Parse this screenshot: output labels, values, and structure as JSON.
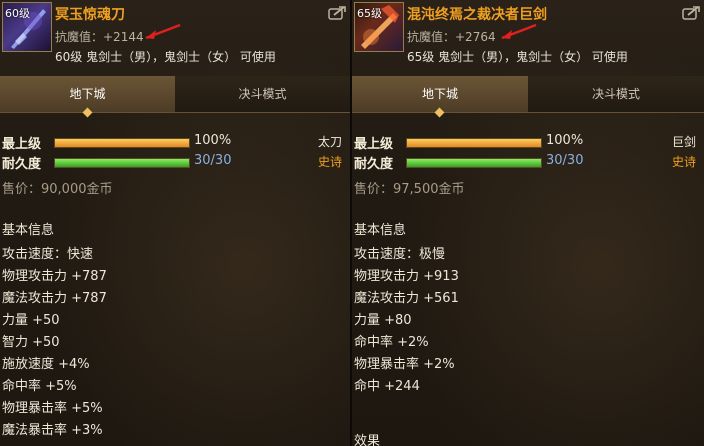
{
  "colors": {
    "item_name": "#f0a020",
    "durability_value": "#8ab0e0",
    "tag_epic": "#f0a020",
    "annotation_arrow": "#e02020"
  },
  "left": {
    "level_badge": "60级",
    "name": "冥玉惊魂刀",
    "magic_resistance": "抗魔值：+2144",
    "requirement": "60级 鬼剑士（男），鬼剑士（女） 可使用",
    "tabs": [
      "地下城",
      "决斗模式"
    ],
    "active_tab": "地下城",
    "stats": {
      "max_level_label": "最上级",
      "max_level_value": "100%",
      "max_level_fraction": 1.0,
      "durability_label": "耐久度",
      "durability_value": "30/30",
      "durability_fraction": 1.0
    },
    "weapon_type": "太刀",
    "rarity": "史诗",
    "price": "售价：90,000金币",
    "section_title": "基本信息",
    "attributes": [
      "攻击速度：快速",
      "物理攻击力 +787",
      "魔法攻击力 +787",
      "力量 +50",
      "智力 +50",
      "施放速度 +4%",
      "命中率 +5%",
      "物理暴击率 +5%",
      "魔法暴击率 +3%"
    ]
  },
  "right": {
    "level_badge": "65级",
    "name": "混沌终焉之裁决者巨剑",
    "magic_resistance": "抗魔值：+2764",
    "requirement": "65级 鬼剑士（男），鬼剑士（女） 可使用",
    "tabs": [
      "地下城",
      "决斗模式"
    ],
    "active_tab": "地下城",
    "stats": {
      "max_level_label": "最上级",
      "max_level_value": "100%",
      "max_level_fraction": 1.0,
      "durability_label": "耐久度",
      "durability_value": "30/30",
      "durability_fraction": 1.0
    },
    "weapon_type": "巨剑",
    "rarity": "史诗",
    "price": "售价：97,500金币",
    "section_title": "基本信息",
    "attributes": [
      "攻击速度：极慢",
      "物理攻击力 +913",
      "魔法攻击力 +561",
      "力量 +80",
      "命中率 +2%",
      "物理暴击率 +2%",
      "命中 +244"
    ],
    "effect_title": "效果"
  }
}
